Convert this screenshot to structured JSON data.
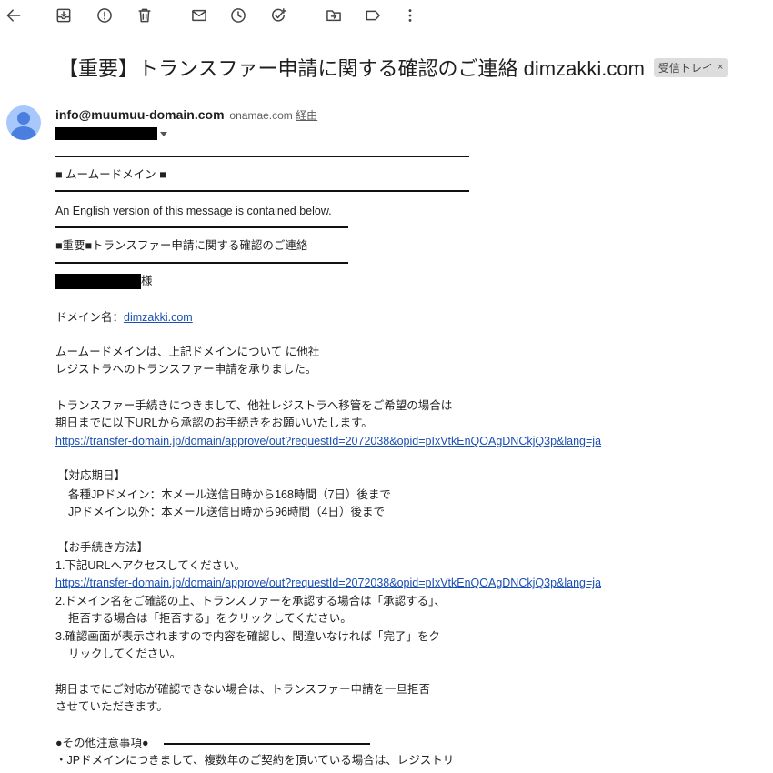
{
  "toolbar": {
    "icons": [
      "back-arrow-icon",
      "archive-icon",
      "report-spam-icon",
      "delete-icon",
      "mark-unread-icon",
      "snooze-icon",
      "add-to-tasks-icon",
      "move-to-icon",
      "label-icon",
      "more-vert-icon"
    ]
  },
  "subject": {
    "text": "【重要】トランスファー申請に関する確認のご連絡 dimzakki.com",
    "label": "受信トレイ",
    "label_close": "×"
  },
  "sender": {
    "email": "info@muumuu-domain.com",
    "via_domain": "onamae.com",
    "via_text": "経由"
  },
  "body": {
    "brand": "■ ムームードメイン ■",
    "english_note": "An English version of this message is contained below.",
    "heading": "■重要■トランスファー申請に関する確認のご連絡",
    "salutation_suffix": "様",
    "domain_label": "ドメイン名：",
    "domain_link": "dimzakki.com",
    "para1_line1": "ムームードメインは、上記ドメインについて に他社",
    "para1_line2": "レジストラへのトランスファー申請を承りました。",
    "para2_line1": "トランスファー手続きにつきまして、他社レジストラへ移管をご希望の場合は",
    "para2_line2": "期日までに以下URLから承認のお手続きをお願いいたします。",
    "url1": "https://transfer-domain.jp/domain/approve/out?requestId=2072038&opid=pIxVtkEnQOAgDNCkjQ3p&lang=ja",
    "deadline_heading": "【対応期日】",
    "deadline_jp": "各種JPドメイン：本メール送信日時から168時間（7日）後まで",
    "deadline_other": "JPドメイン以外：本メール送信日時から96時間（4日）後まで",
    "procedure_heading": "【お手続き方法】",
    "step1": "1.下記URLへアクセスしてください。",
    "url2": "https://transfer-domain.jp/domain/approve/out?requestId=2072038&opid=pIxVtkEnQOAgDNCkjQ3p&lang=ja",
    "step2_line1": "2.ドメイン名をご確認の上、トランスファーを承認する場合は「承認する」、",
    "step2_line2": "拒否する場合は「拒否する」をクリックしてください。",
    "step3_line1": "3.確認画面が表示されますので内容を確認し、間違いなければ「完了」をク",
    "step3_line2": "リックしてください。",
    "para3_line1": "期日までにご対応が確認できない場合は、トランスファー申請を一旦拒否",
    "para3_line2": "させていただきます。",
    "notes_heading": "●その他注意事項●",
    "notes_line1": "・JPドメインにつきまして、複数年のご契約を頂いている場合は、レジストリ"
  }
}
